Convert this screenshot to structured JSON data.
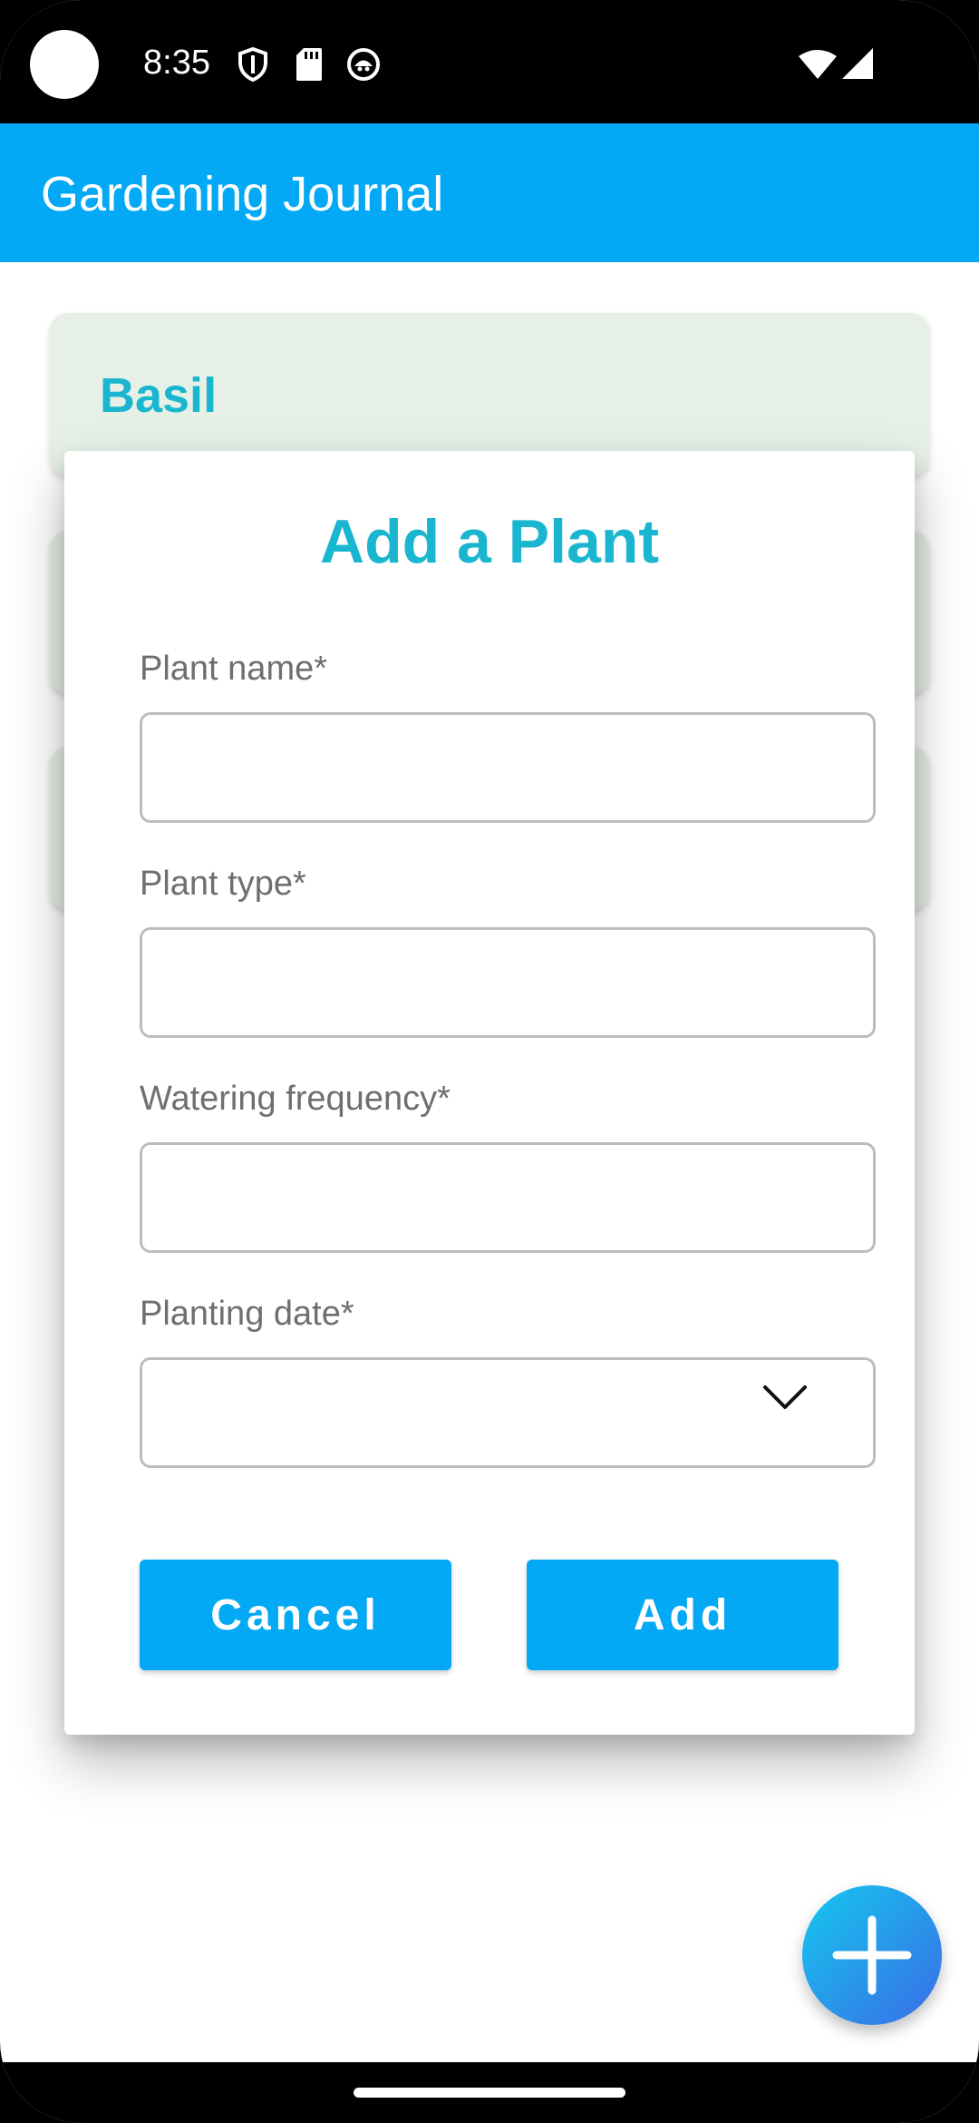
{
  "status_bar": {
    "time": "8:35"
  },
  "app_bar": {
    "title": "Gardening Journal",
    "color": "#03A9F4"
  },
  "plants": [
    {
      "name": "Basil"
    },
    {
      "name": ""
    },
    {
      "name": ""
    }
  ],
  "dialog": {
    "title": "Add a Plant",
    "fields": {
      "plant_name": {
        "label": "Plant name*",
        "value": ""
      },
      "plant_type": {
        "label": "Plant type*",
        "value": ""
      },
      "watering_frequency": {
        "label": "Watering frequency*",
        "value": ""
      },
      "planting_date": {
        "label": "Planting date*",
        "value": ""
      }
    },
    "cancel_label": "Cancel",
    "add_label": "Add"
  },
  "fab": {
    "icon": "plus-icon"
  },
  "colors": {
    "accent": "#03A9F4",
    "title_text": "#1AB6D0",
    "card_bg": "#E6F0E6"
  }
}
